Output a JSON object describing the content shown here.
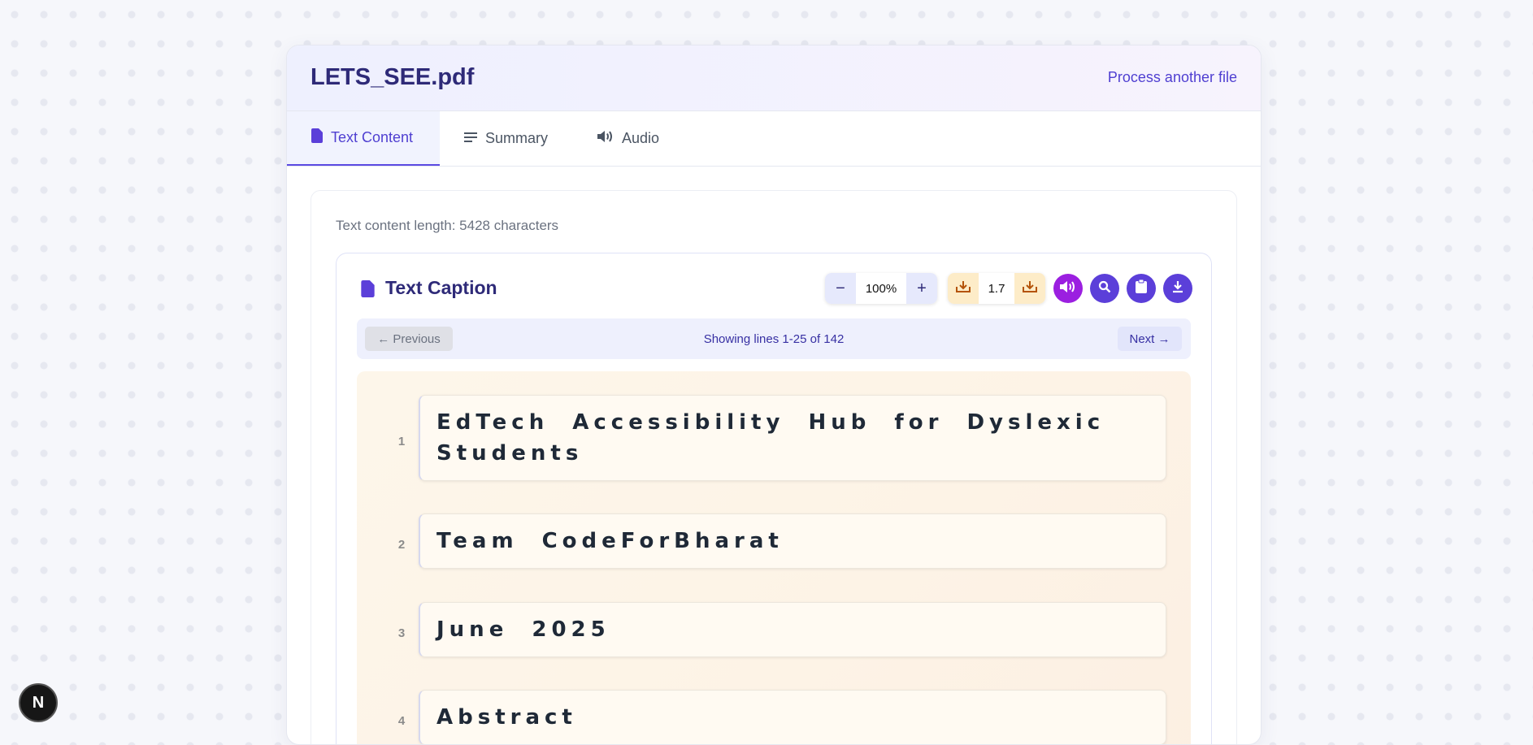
{
  "header": {
    "file_title": "LETS_SEE.pdf",
    "process_link": "Process another file"
  },
  "tabs": [
    {
      "label": "Text Content",
      "icon": "document-icon",
      "active": true
    },
    {
      "label": "Summary",
      "icon": "lines-icon",
      "active": false
    },
    {
      "label": "Audio",
      "icon": "speaker-icon",
      "active": false
    }
  ],
  "content": {
    "length_text": "Text content length: 5428 characters"
  },
  "viewer": {
    "title": "Text Caption",
    "zoom_value": "100%",
    "zoom_out_label": "−",
    "zoom_in_label": "+",
    "speed_value": "1.7",
    "pager": {
      "prev_label": "← Previous",
      "showing_text": "Showing lines 1-25 of 142",
      "next_label": "Next →"
    },
    "lines": [
      {
        "number": "1",
        "text": "EdTech Accessibility Hub for Dyslexic Students"
      },
      {
        "number": "2",
        "text": "Team CodeForBharat"
      },
      {
        "number": "3",
        "text": "June 2025"
      },
      {
        "number": "4",
        "text": "Abstract"
      }
    ]
  },
  "badge": {
    "label": "N"
  },
  "colors": {
    "accent": "#5b3fd9",
    "title": "#2e2a78",
    "audio_button": "#9b1fe0",
    "speed_buttons": "#fdecc8"
  }
}
